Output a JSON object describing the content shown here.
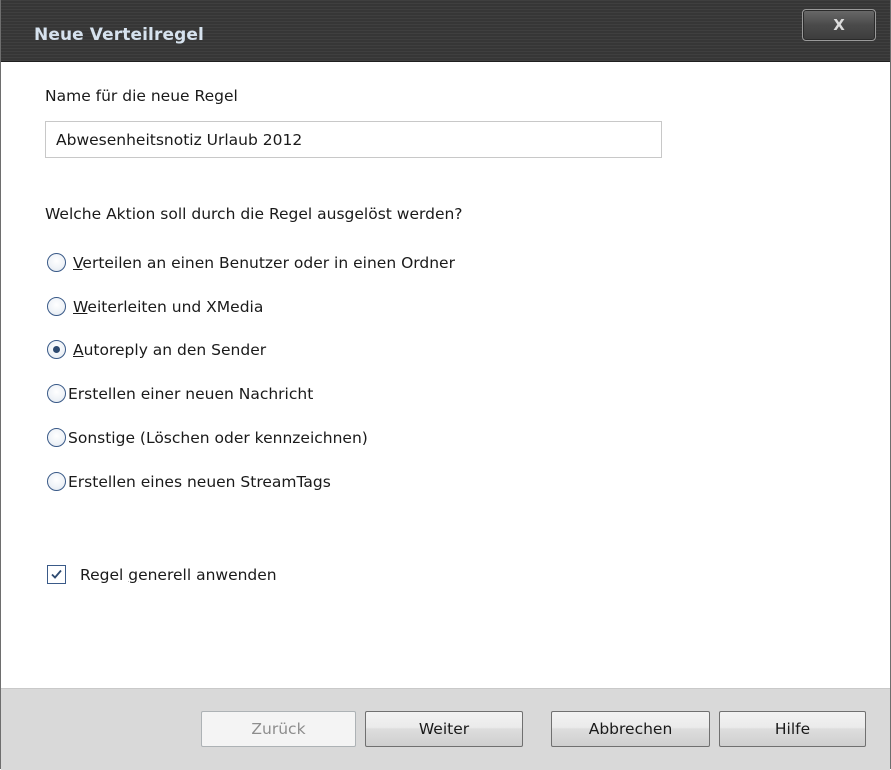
{
  "window": {
    "title": "Neue Verteilregel",
    "close_label": "X"
  },
  "name_section": {
    "label": "Name für die neue Regel",
    "value": "Abwesenheitsnotiz Urlaub 2012"
  },
  "action_section": {
    "question": "Welche Aktion soll durch die Regel ausgelöst werden?",
    "options": [
      {
        "accel": "V",
        "rest": "erteilen an einen Benutzer oder in einen Ordner",
        "checked": false
      },
      {
        "accel": "W",
        "rest": "eiterleiten und XMedia",
        "checked": false
      },
      {
        "accel": "A",
        "rest": "utoreply an den Sender",
        "checked": true
      },
      {
        "accel": "",
        "rest": "Erstellen einer neuen Nachricht",
        "checked": false
      },
      {
        "accel": "",
        "rest": "Sonstige (Löschen oder kennzeichnen)",
        "checked": false
      },
      {
        "accel": "",
        "rest": "Erstellen eines neuen StreamTags",
        "checked": false
      }
    ]
  },
  "apply_rule": {
    "prefix": "Regel ",
    "accel": "g",
    "suffix": "enerell anwenden",
    "checked": true
  },
  "buttons": {
    "back": "Zurück",
    "next": "Weiter",
    "cancel": "Abbrechen",
    "help": "Hilfe"
  }
}
